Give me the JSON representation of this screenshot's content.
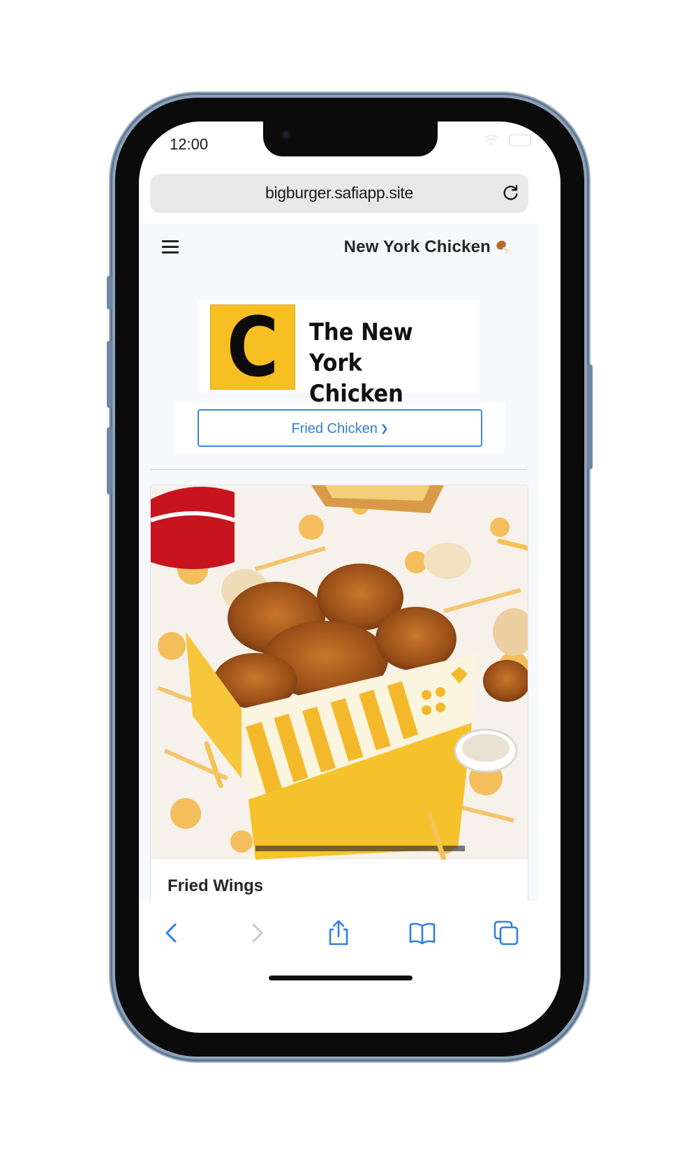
{
  "status_bar": {
    "time": "12:00"
  },
  "browser": {
    "url": "bigburger.safiapp.site"
  },
  "header": {
    "title": "New York Chicken"
  },
  "logo": {
    "letter": "C",
    "name": "The New York Chicken",
    "accent_color": "#f7bf22"
  },
  "category": {
    "selected": "Fried Chicken",
    "accent_color": "#2f7fd3"
  },
  "products": [
    {
      "name": "Fried Wings"
    }
  ]
}
